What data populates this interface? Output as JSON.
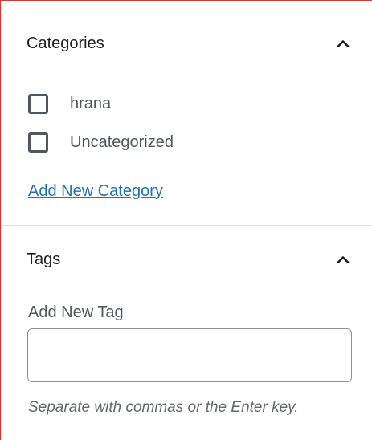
{
  "categories": {
    "title": "Categories",
    "toggle_icon": "chevron-up-icon",
    "items": [
      {
        "label": "hrana",
        "checked": false
      },
      {
        "label": "Uncategorized",
        "checked": false
      }
    ],
    "add_link": "Add New Category"
  },
  "tags": {
    "title": "Tags",
    "toggle_icon": "chevron-up-icon",
    "input_label": "Add New Tag",
    "input_value": "",
    "help_text": "Separate with commas or the Enter key."
  },
  "colors": {
    "link": "#2271b1",
    "error_border": "#d63638",
    "checkbox_border": "#50575e"
  }
}
